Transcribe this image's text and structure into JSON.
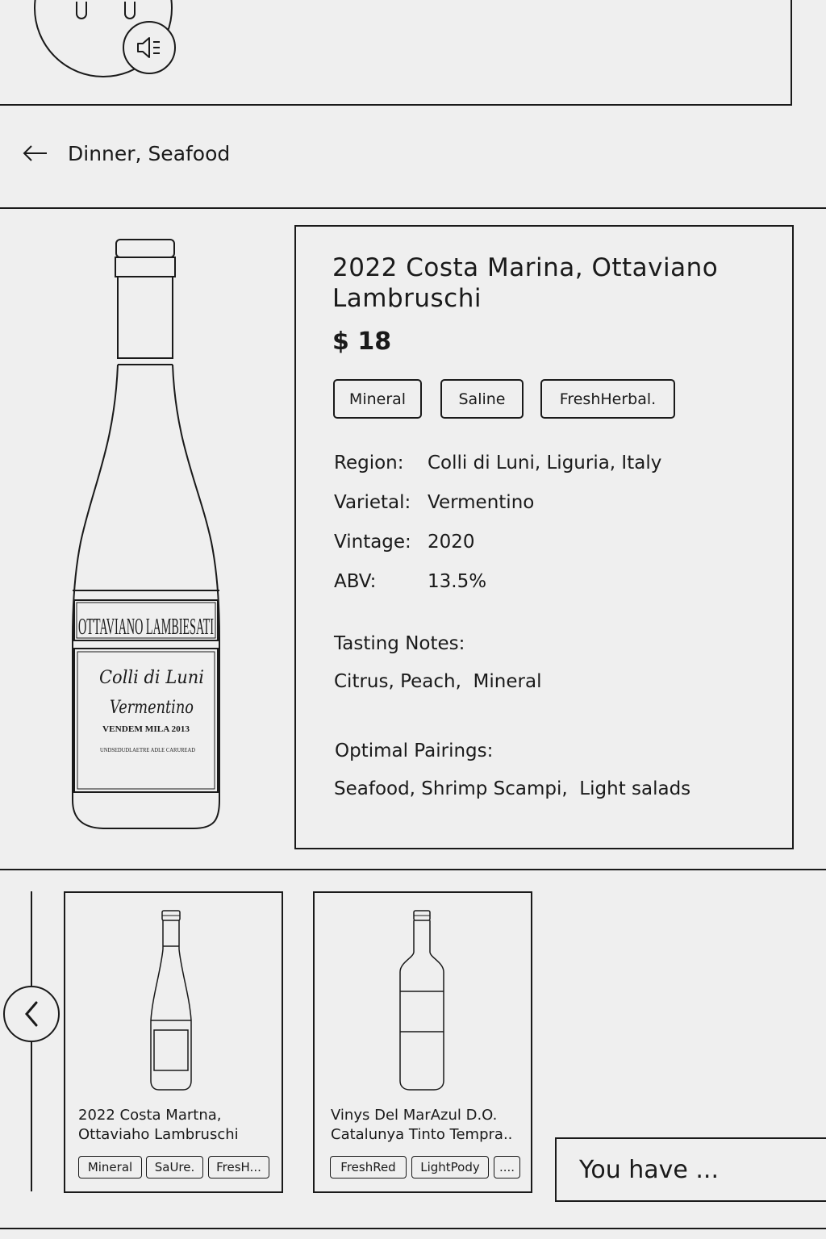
{
  "nav": {
    "back_label": "Dinner, Seafood"
  },
  "wine": {
    "title": "2022 Costa Marina, Ottaviano Lambruschi",
    "price": "$ 18",
    "tags": [
      "Mineral",
      "Saline",
      "FreshHerbal."
    ],
    "specs": [
      {
        "key": "Region:",
        "value": "Colli di Luni, Liguria, Italy"
      },
      {
        "key": "Varietal:",
        "value": "Vermentino"
      },
      {
        "key": "Vintage:",
        "value": "2020"
      },
      {
        "key": "ABV:",
        "value": "13.5%"
      }
    ],
    "tasting_notes_label": "Tasting Notes:",
    "tasting_notes": "Citrus, Peach,  Mineral",
    "pairings_label": "Optimal Pairings:",
    "pairings": "Seafood, Shrimp Scampi,  Light salads",
    "label_text": {
      "producer": "OTTAVIANO LAMBIESATI",
      "script_line1": "Colli di Luni",
      "script_line2": "Vermentino",
      "vendemmia": "VENDEM MILA 2013",
      "small_print": "UNDSEDUDLAETRE ADLE CARUREAD"
    }
  },
  "recommendations": [
    {
      "name_line1": "2022 Costa Martna,",
      "name_line2": "Ottaviaho Lambruschi",
      "tags": [
        "Mineral",
        "SaUre.",
        "FresH..."
      ]
    },
    {
      "name_line1": "Vinys Del MarAzul D.O.",
      "name_line2": "Catalunya Tinto Tempra..",
      "tags": [
        "FreshRed",
        "LightPody",
        "...."
      ]
    }
  ],
  "chat": {
    "input_text": "You have ..."
  },
  "icons": {
    "speaker": "speaker-icon",
    "back": "arrow-left-icon",
    "prev": "chevron-left-icon"
  }
}
